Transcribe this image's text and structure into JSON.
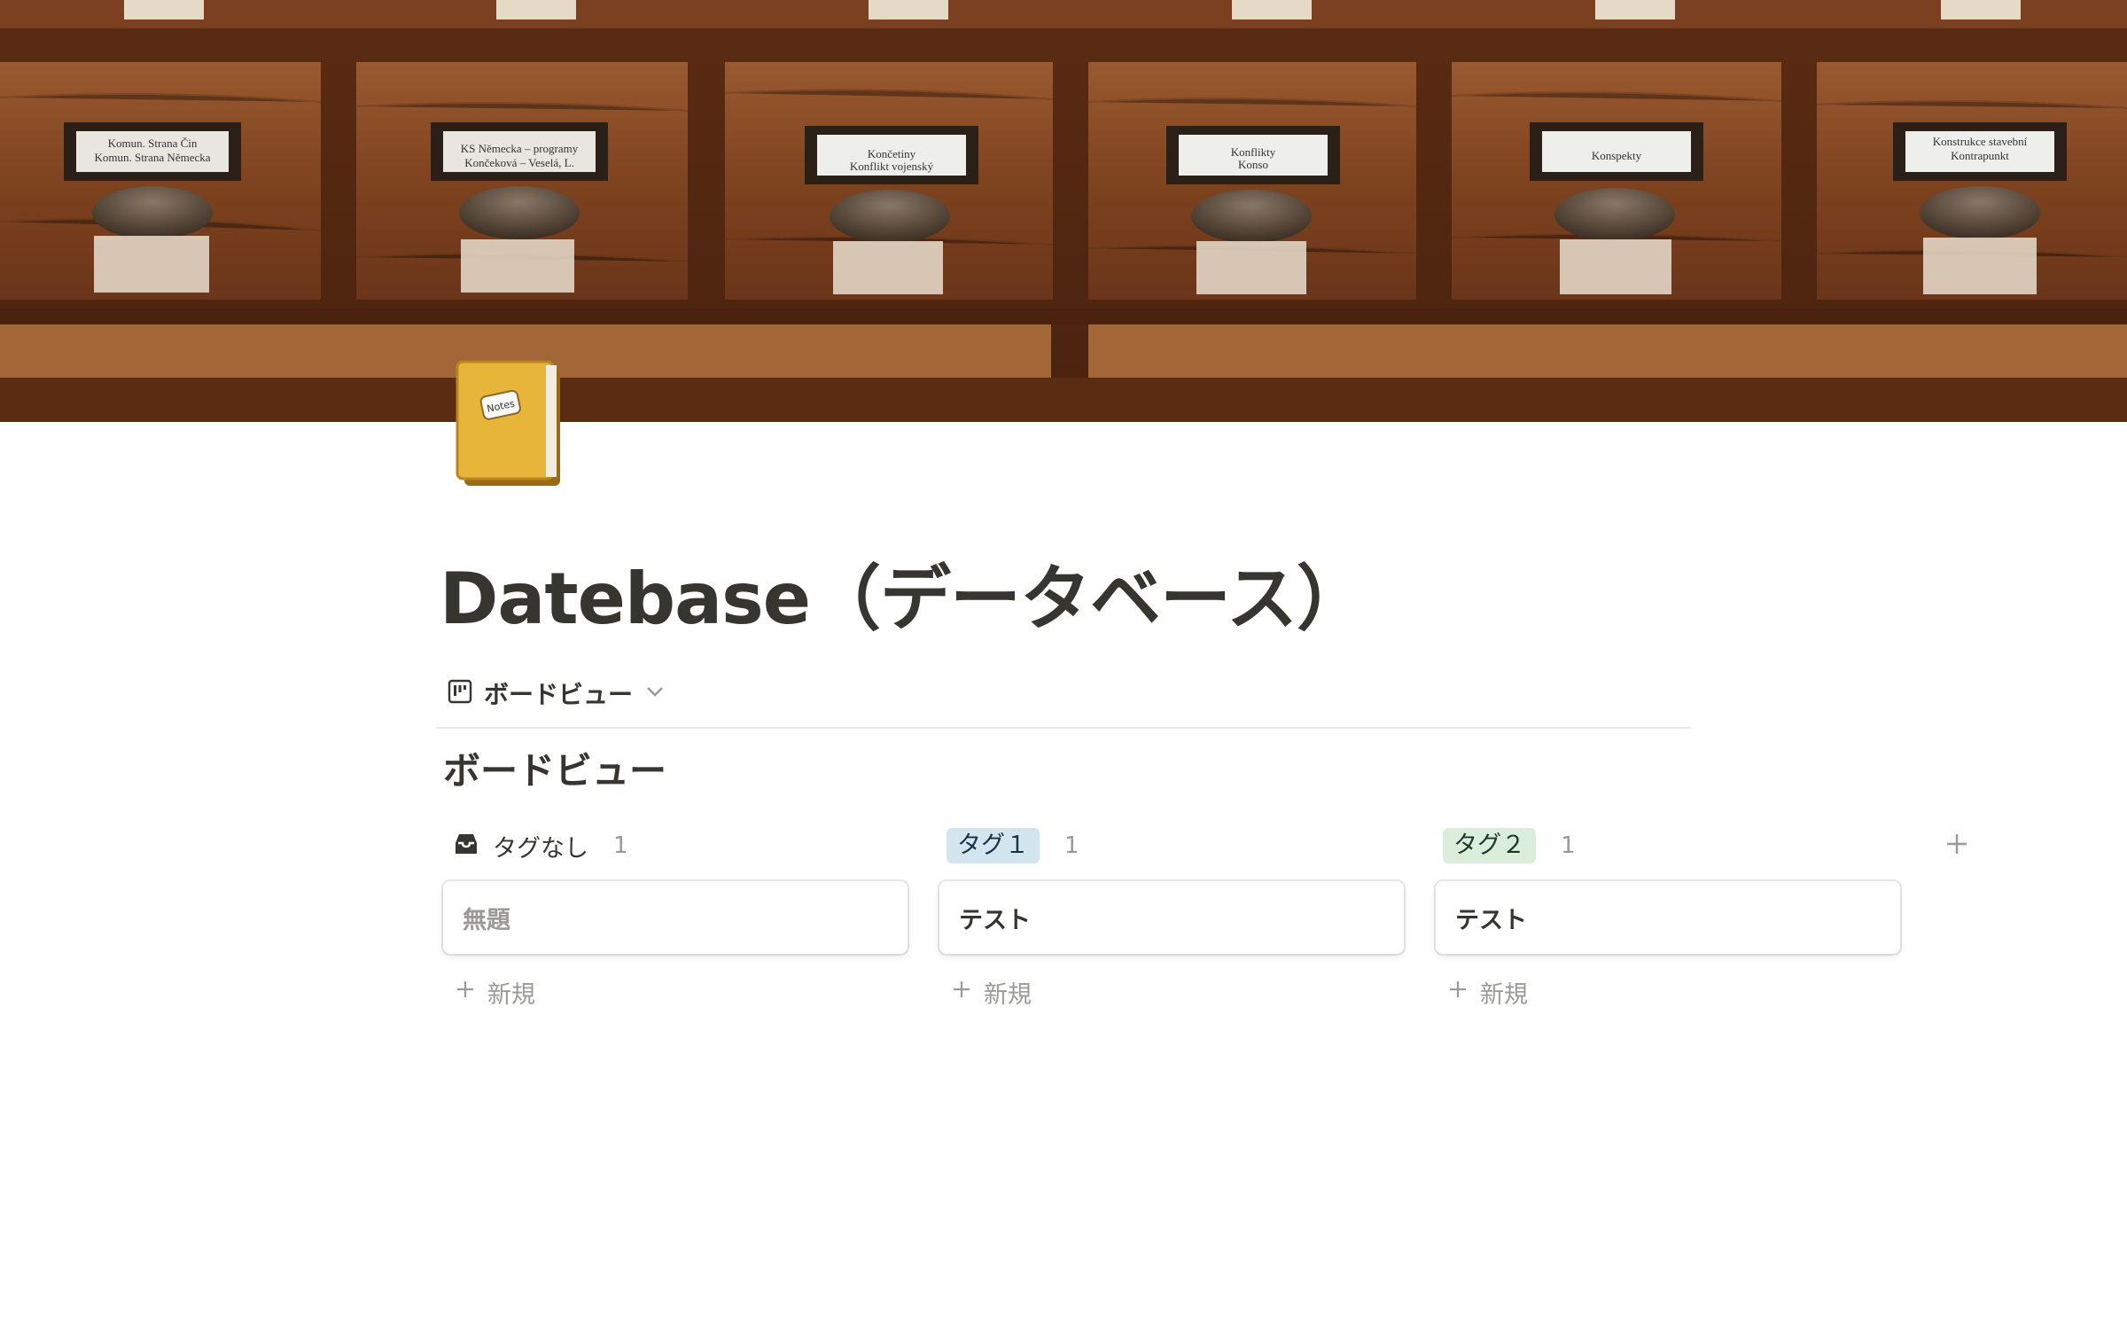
{
  "page": {
    "title": "Datebase（データベース）",
    "cover": "card-catalog-drawers-photo",
    "cover_drawer_labels": [
      "Komun. Strana Čin / Komun. Strana Německa",
      "KS Německa – programy / Končeková – Veselá, L.",
      "Končetiny / Konflikt vojenský",
      "Konflikty / Konso",
      "Konspekty",
      "Konstrukce stavební / Kontrapunkt"
    ],
    "icon": "notebook-icon",
    "icon_text": "Notes"
  },
  "view": {
    "switcher_label": "ボードビュー",
    "icon": "board-view-icon",
    "board_title": "ボードビュー"
  },
  "board": {
    "groups": [
      {
        "label": "タグなし",
        "count": "1",
        "icon": "inbox-icon",
        "cards": [
          {
            "title": "無題"
          }
        ],
        "new_label": "新規"
      },
      {
        "label": "タグ１",
        "count": "1",
        "color_bg": "#d3e5ef",
        "color_fg": "#183347",
        "cards": [
          {
            "title": "テスト"
          }
        ],
        "new_label": "新規"
      },
      {
        "label": "タグ２",
        "count": "1",
        "color_bg": "#dbeddb",
        "color_fg": "#1c3829",
        "cards": [
          {
            "title": "テスト"
          }
        ],
        "new_label": "新規"
      }
    ],
    "add_group_icon": "plus-icon"
  }
}
